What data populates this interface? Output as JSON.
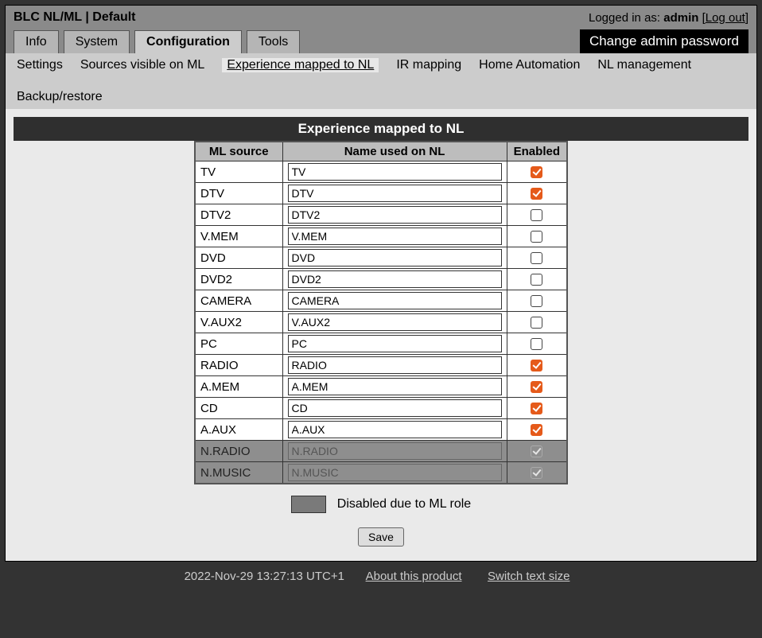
{
  "header": {
    "brand": "BLC NL/ML | Default",
    "logged_in_prefix": "Logged in as: ",
    "user": "admin",
    "logout": "Log out",
    "change_pw": "Change admin password"
  },
  "tabs": [
    "Info",
    "System",
    "Configuration",
    "Tools"
  ],
  "tabs_active": 2,
  "subnav": [
    "Settings",
    "Sources visible on ML",
    "Experience mapped to NL",
    "IR mapping",
    "Home Automation",
    "NL management",
    "Backup/restore"
  ],
  "subnav_active": 2,
  "panel_title": "Experience mapped to NL",
  "columns": {
    "ml": "ML source",
    "name": "Name used on NL",
    "enabled": "Enabled"
  },
  "rows": [
    {
      "ml": "TV",
      "name": "TV",
      "enabled": true,
      "disabled": false
    },
    {
      "ml": "DTV",
      "name": "DTV",
      "enabled": true,
      "disabled": false
    },
    {
      "ml": "DTV2",
      "name": "DTV2",
      "enabled": false,
      "disabled": false
    },
    {
      "ml": "V.MEM",
      "name": "V.MEM",
      "enabled": false,
      "disabled": false
    },
    {
      "ml": "DVD",
      "name": "DVD",
      "enabled": false,
      "disabled": false
    },
    {
      "ml": "DVD2",
      "name": "DVD2",
      "enabled": false,
      "disabled": false
    },
    {
      "ml": "CAMERA",
      "name": "CAMERA",
      "enabled": false,
      "disabled": false
    },
    {
      "ml": "V.AUX2",
      "name": "V.AUX2",
      "enabled": false,
      "disabled": false
    },
    {
      "ml": "PC",
      "name": "PC",
      "enabled": false,
      "disabled": false
    },
    {
      "ml": "RADIO",
      "name": "RADIO",
      "enabled": true,
      "disabled": false
    },
    {
      "ml": "A.MEM",
      "name": "A.MEM",
      "enabled": true,
      "disabled": false
    },
    {
      "ml": "CD",
      "name": "CD",
      "enabled": true,
      "disabled": false
    },
    {
      "ml": "A.AUX",
      "name": "A.AUX",
      "enabled": true,
      "disabled": false
    },
    {
      "ml": "N.RADIO",
      "name": "N.RADIO",
      "enabled": true,
      "disabled": true
    },
    {
      "ml": "N.MUSIC",
      "name": "N.MUSIC",
      "enabled": true,
      "disabled": true
    }
  ],
  "legend": "Disabled due to ML role",
  "save": "Save",
  "footer": {
    "timestamp": "2022-Nov-29 13:27:13 UTC+1",
    "about": "About this product",
    "textsize": "Switch text size"
  }
}
